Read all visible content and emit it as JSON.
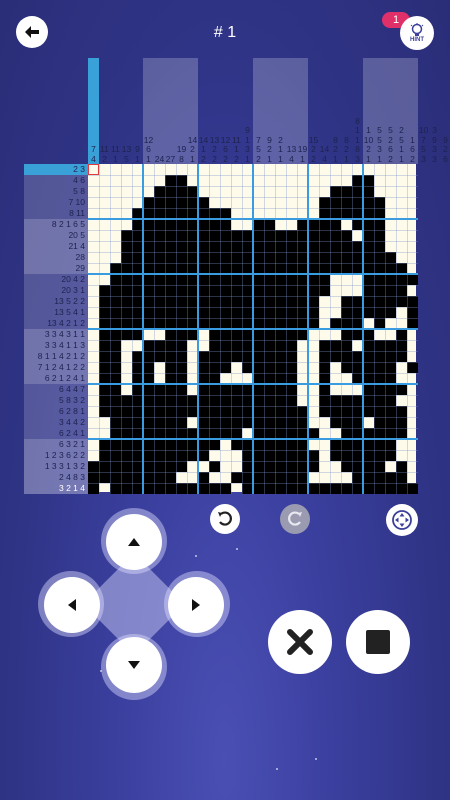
{
  "header": {
    "title": "# 1",
    "hint_label": "HINT",
    "hint_count": "1"
  },
  "puzzle": {
    "column_clues": [
      [
        "7",
        "4"
      ],
      [
        "11",
        "2"
      ],
      [
        "11",
        "1"
      ],
      [
        "13",
        "5"
      ],
      [
        "9",
        "1"
      ],
      [
        "12",
        "6",
        "1"
      ],
      [
        "24"
      ],
      [
        "27"
      ],
      [
        "19",
        "8"
      ],
      [
        "14",
        "2",
        "1"
      ],
      [
        "14",
        "1",
        "2"
      ],
      [
        "13",
        "2",
        "2"
      ],
      [
        "12",
        "6",
        "2"
      ],
      [
        "11",
        "1",
        "2"
      ],
      [
        "9",
        "1",
        "3",
        "1"
      ],
      [
        "7",
        "5",
        "2"
      ],
      [
        "9",
        "2",
        "1"
      ],
      [
        "2",
        "1",
        "1"
      ],
      [
        "13",
        "4"
      ],
      [
        "19",
        "1"
      ],
      [
        "15",
        "2",
        "2"
      ],
      [
        "14",
        "4"
      ],
      [
        "8",
        "2",
        "1"
      ],
      [
        "8",
        "2",
        "1"
      ],
      [
        "8",
        "1",
        "1",
        "8",
        "3"
      ],
      [
        "1",
        "10",
        "2",
        "1"
      ],
      [
        "5",
        "5",
        "3",
        "1"
      ],
      [
        "5",
        "2",
        "6",
        "2"
      ],
      [
        "2",
        "5",
        "1",
        "1"
      ],
      [
        "1",
        "6",
        "2"
      ],
      [
        "10",
        "7",
        "5",
        "3"
      ],
      [
        "3",
        "9",
        "3",
        "3"
      ],
      [
        "9",
        "2",
        "6"
      ],
      [
        "10",
        "6"
      ]
    ],
    "row_clues": [
      "2 3",
      "4 6",
      "5 8",
      "7 10",
      "8 11",
      "8 2 1 6 5",
      "20 5",
      "21 4",
      "28",
      "29",
      "20 4 2",
      "20 3 1",
      "13 5 2 2",
      "13 5 4 1",
      "13 4 2 1 2",
      "3 3 4 3 1 1",
      "3 3 4 1 1 3",
      "8 1 1 4 2 1 2",
      "7 1 2 4 1 2 2",
      "6 2 1 2 4 1",
      "6 4 4 7",
      "5 8 3 2",
      "6 2 8 1",
      "3 4 4 2",
      "6 2 4 1",
      "6 3 2 1",
      "1 2 3 6 2 2",
      "1 3 3 1 3 2",
      "2 4 8 3",
      "3 2 1 4"
    ],
    "highlight_row": 0,
    "highlight_col": 0,
    "cursor_row_label": "3",
    "cursor_col_label": "1"
  },
  "grid_rows": [
    "000000000000000000000000000000",
    "000000011000000000000000110000",
    "000000111100000000000011110000",
    "000001111110000000000111111000",
    "000011111111100000000111111000",
    "000011111111100110011110111000",
    "000111111111111111111111011000",
    "000111111111111111111111111000",
    "000111111111111111111111111100",
    "001111111111111111111111111110",
    "001111111111111111111100011111",
    "011111111111111111111100011110",
    "011111111111111111111001111111",
    "011111111111111111111001111101",
    "011111111111111111111011101001",
    "011110011101111111110001110010",
    "011001111001111111100111011110",
    "011011111011111111100111111110",
    "011011011011101111100101111101",
    "011011011011000111100100111100",
    "011011111011111111100100011110",
    "011111111111111111100111111100",
    "011111111111111111110111111110",
    "001111111011111111110011101110",
    "001111111111110111111001111110",
    "011111111111011111110011111100",
    "011111111110001111111011111100",
    "111111111001001111111001111010",
    "111111110010011111110000111110",
    "101111111111101111111111111111"
  ],
  "controls": {
    "undo": "undo-icon",
    "redo": "redo-icon",
    "move": "move-icon",
    "cross": "cross-icon",
    "fill": "fill-square-icon"
  }
}
